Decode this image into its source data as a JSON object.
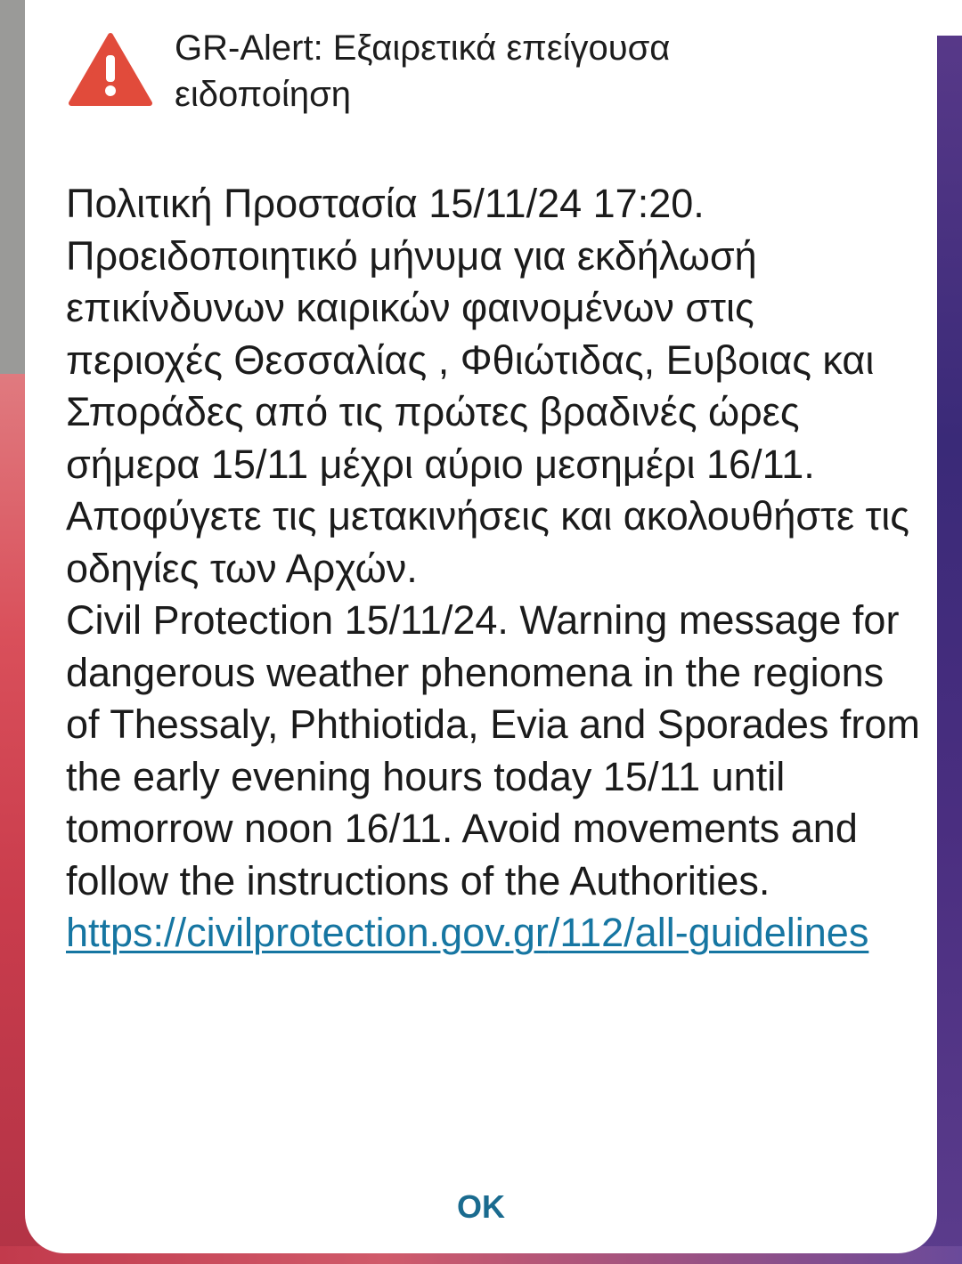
{
  "alert": {
    "title": "GR-Alert: Εξαιρετικά επείγουσα ειδοποίηση",
    "icon": "warning-triangle-icon",
    "icon_color": "#e14b3b",
    "message_greek": "Πολιτική Προστασία 15/11/24 17:20. Προειδοποιητικό μήνυμα για εκδήλωσή επικίνδυνων καιρικών φαινομένων στις περιοχές Θεσσαλίας , Φθιώτιδας, Ευβοιας και Σποράδες από τις πρώτες βραδινές ώρες σήμερα 15/11 μέχρι αύριο μεσημέρι 16/11. Αποφύγετε τις μετακινήσεις και ακολουθήστε τις οδηγίες των Αρχών.",
    "message_english": "Civil Protection 15/11/24. Warning message for dangerous weather phenomena in the regions of Thessaly, Phthiotida, Evia and Sporades from the early evening hours today 15/11 until tomorrow noon 16/11. Avoid movements and follow the instructions of the Authorities.",
    "link_text": "https://civilprotection.gov.gr/112/all-guidelines",
    "link_color": "#1676a2",
    "ok_label": "OK",
    "ok_color": "#1a6b8f"
  }
}
